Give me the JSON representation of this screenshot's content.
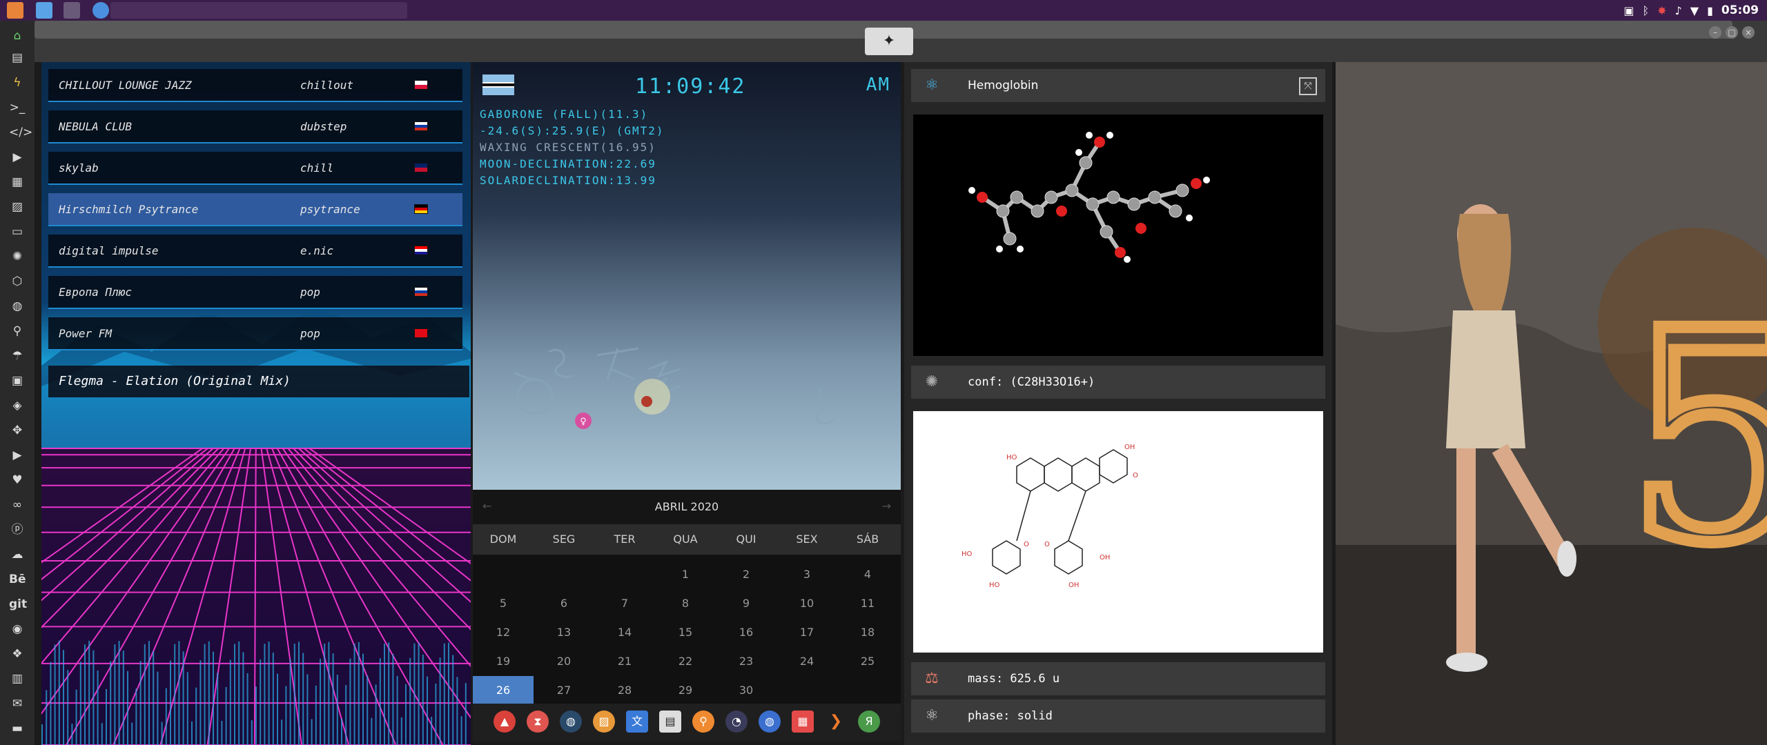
{
  "topbar": {
    "clock": "05:09",
    "tray_icons": [
      "image-icon",
      "bluetooth-icon",
      "gear-red-icon",
      "volume-icon",
      "wifi-icon",
      "battery-icon"
    ]
  },
  "radio": {
    "stations": [
      {
        "name": "CHILLOUT LOUNGE JAZZ",
        "genre": "chillout",
        "flag": "poland"
      },
      {
        "name": "NEBULA CLUB",
        "genre": "dubstep",
        "flag": "russia"
      },
      {
        "name": "skylab",
        "genre": "chill",
        "flag": "uk"
      },
      {
        "name": "Hirschmilch Psytrance",
        "genre": "psytrance",
        "flag": "germany"
      },
      {
        "name": "digital impulse",
        "genre": "e.nic",
        "flag": "croatia"
      },
      {
        "name": "Европа Плюс",
        "genre": "pop",
        "flag": "russia"
      },
      {
        "name": "Power FM",
        "genre": "pop",
        "flag": "turkey"
      }
    ],
    "active_index": 3,
    "now_playing": "Flegma - Elation (Original Mix)"
  },
  "sky": {
    "time": "11:09:42",
    "ampm": "AM",
    "lines": [
      "GABORONE (FALL)(11.3)",
      "-24.6(S):25.9(E) (GMT2)",
      "WAXING CRESCENT(16.95)",
      "MOON-DECLINATION:22.69",
      "SOLARDECLINATION:13.99"
    ]
  },
  "calendar": {
    "month": "ABRIL 2020",
    "dow": [
      "DOM",
      "SEG",
      "TER",
      "QUA",
      "QUI",
      "SEX",
      "SÁB"
    ],
    "first_weekday": 3,
    "days": 30,
    "today": 26
  },
  "molecule": {
    "name": "Hemoglobin",
    "conf": "conf: (C28H33O16+)",
    "mass": "mass: 625.6 u",
    "phase": "phase: solid"
  },
  "colors": {
    "accent": "#3cc8e8",
    "active_station": "#2f5a9e",
    "today": "#4a7fc6"
  }
}
